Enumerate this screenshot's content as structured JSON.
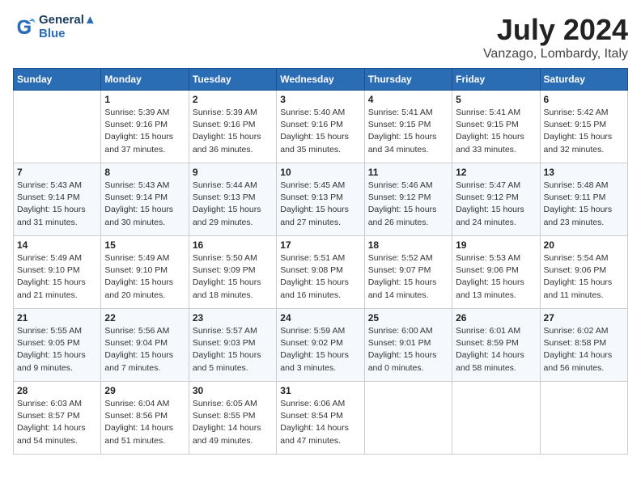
{
  "logo": {
    "line1": "General",
    "line2": "Blue"
  },
  "title": "July 2024",
  "location": "Vanzago, Lombardy, Italy",
  "header_days": [
    "Sunday",
    "Monday",
    "Tuesday",
    "Wednesday",
    "Thursday",
    "Friday",
    "Saturday"
  ],
  "weeks": [
    [
      {
        "day": "",
        "sunrise": "",
        "sunset": "",
        "daylight": ""
      },
      {
        "day": "1",
        "sunrise": "Sunrise: 5:39 AM",
        "sunset": "Sunset: 9:16 PM",
        "daylight": "Daylight: 15 hours and 37 minutes."
      },
      {
        "day": "2",
        "sunrise": "Sunrise: 5:39 AM",
        "sunset": "Sunset: 9:16 PM",
        "daylight": "Daylight: 15 hours and 36 minutes."
      },
      {
        "day": "3",
        "sunrise": "Sunrise: 5:40 AM",
        "sunset": "Sunset: 9:16 PM",
        "daylight": "Daylight: 15 hours and 35 minutes."
      },
      {
        "day": "4",
        "sunrise": "Sunrise: 5:41 AM",
        "sunset": "Sunset: 9:15 PM",
        "daylight": "Daylight: 15 hours and 34 minutes."
      },
      {
        "day": "5",
        "sunrise": "Sunrise: 5:41 AM",
        "sunset": "Sunset: 9:15 PM",
        "daylight": "Daylight: 15 hours and 33 minutes."
      },
      {
        "day": "6",
        "sunrise": "Sunrise: 5:42 AM",
        "sunset": "Sunset: 9:15 PM",
        "daylight": "Daylight: 15 hours and 32 minutes."
      }
    ],
    [
      {
        "day": "7",
        "sunrise": "Sunrise: 5:43 AM",
        "sunset": "Sunset: 9:14 PM",
        "daylight": "Daylight: 15 hours and 31 minutes."
      },
      {
        "day": "8",
        "sunrise": "Sunrise: 5:43 AM",
        "sunset": "Sunset: 9:14 PM",
        "daylight": "Daylight: 15 hours and 30 minutes."
      },
      {
        "day": "9",
        "sunrise": "Sunrise: 5:44 AM",
        "sunset": "Sunset: 9:13 PM",
        "daylight": "Daylight: 15 hours and 29 minutes."
      },
      {
        "day": "10",
        "sunrise": "Sunrise: 5:45 AM",
        "sunset": "Sunset: 9:13 PM",
        "daylight": "Daylight: 15 hours and 27 minutes."
      },
      {
        "day": "11",
        "sunrise": "Sunrise: 5:46 AM",
        "sunset": "Sunset: 9:12 PM",
        "daylight": "Daylight: 15 hours and 26 minutes."
      },
      {
        "day": "12",
        "sunrise": "Sunrise: 5:47 AM",
        "sunset": "Sunset: 9:12 PM",
        "daylight": "Daylight: 15 hours and 24 minutes."
      },
      {
        "day": "13",
        "sunrise": "Sunrise: 5:48 AM",
        "sunset": "Sunset: 9:11 PM",
        "daylight": "Daylight: 15 hours and 23 minutes."
      }
    ],
    [
      {
        "day": "14",
        "sunrise": "Sunrise: 5:49 AM",
        "sunset": "Sunset: 9:10 PM",
        "daylight": "Daylight: 15 hours and 21 minutes."
      },
      {
        "day": "15",
        "sunrise": "Sunrise: 5:49 AM",
        "sunset": "Sunset: 9:10 PM",
        "daylight": "Daylight: 15 hours and 20 minutes."
      },
      {
        "day": "16",
        "sunrise": "Sunrise: 5:50 AM",
        "sunset": "Sunset: 9:09 PM",
        "daylight": "Daylight: 15 hours and 18 minutes."
      },
      {
        "day": "17",
        "sunrise": "Sunrise: 5:51 AM",
        "sunset": "Sunset: 9:08 PM",
        "daylight": "Daylight: 15 hours and 16 minutes."
      },
      {
        "day": "18",
        "sunrise": "Sunrise: 5:52 AM",
        "sunset": "Sunset: 9:07 PM",
        "daylight": "Daylight: 15 hours and 14 minutes."
      },
      {
        "day": "19",
        "sunrise": "Sunrise: 5:53 AM",
        "sunset": "Sunset: 9:06 PM",
        "daylight": "Daylight: 15 hours and 13 minutes."
      },
      {
        "day": "20",
        "sunrise": "Sunrise: 5:54 AM",
        "sunset": "Sunset: 9:06 PM",
        "daylight": "Daylight: 15 hours and 11 minutes."
      }
    ],
    [
      {
        "day": "21",
        "sunrise": "Sunrise: 5:55 AM",
        "sunset": "Sunset: 9:05 PM",
        "daylight": "Daylight: 15 hours and 9 minutes."
      },
      {
        "day": "22",
        "sunrise": "Sunrise: 5:56 AM",
        "sunset": "Sunset: 9:04 PM",
        "daylight": "Daylight: 15 hours and 7 minutes."
      },
      {
        "day": "23",
        "sunrise": "Sunrise: 5:57 AM",
        "sunset": "Sunset: 9:03 PM",
        "daylight": "Daylight: 15 hours and 5 minutes."
      },
      {
        "day": "24",
        "sunrise": "Sunrise: 5:59 AM",
        "sunset": "Sunset: 9:02 PM",
        "daylight": "Daylight: 15 hours and 3 minutes."
      },
      {
        "day": "25",
        "sunrise": "Sunrise: 6:00 AM",
        "sunset": "Sunset: 9:01 PM",
        "daylight": "Daylight: 15 hours and 0 minutes."
      },
      {
        "day": "26",
        "sunrise": "Sunrise: 6:01 AM",
        "sunset": "Sunset: 8:59 PM",
        "daylight": "Daylight: 14 hours and 58 minutes."
      },
      {
        "day": "27",
        "sunrise": "Sunrise: 6:02 AM",
        "sunset": "Sunset: 8:58 PM",
        "daylight": "Daylight: 14 hours and 56 minutes."
      }
    ],
    [
      {
        "day": "28",
        "sunrise": "Sunrise: 6:03 AM",
        "sunset": "Sunset: 8:57 PM",
        "daylight": "Daylight: 14 hours and 54 minutes."
      },
      {
        "day": "29",
        "sunrise": "Sunrise: 6:04 AM",
        "sunset": "Sunset: 8:56 PM",
        "daylight": "Daylight: 14 hours and 51 minutes."
      },
      {
        "day": "30",
        "sunrise": "Sunrise: 6:05 AM",
        "sunset": "Sunset: 8:55 PM",
        "daylight": "Daylight: 14 hours and 49 minutes."
      },
      {
        "day": "31",
        "sunrise": "Sunrise: 6:06 AM",
        "sunset": "Sunset: 8:54 PM",
        "daylight": "Daylight: 14 hours and 47 minutes."
      },
      {
        "day": "",
        "sunrise": "",
        "sunset": "",
        "daylight": ""
      },
      {
        "day": "",
        "sunrise": "",
        "sunset": "",
        "daylight": ""
      },
      {
        "day": "",
        "sunrise": "",
        "sunset": "",
        "daylight": ""
      }
    ]
  ]
}
